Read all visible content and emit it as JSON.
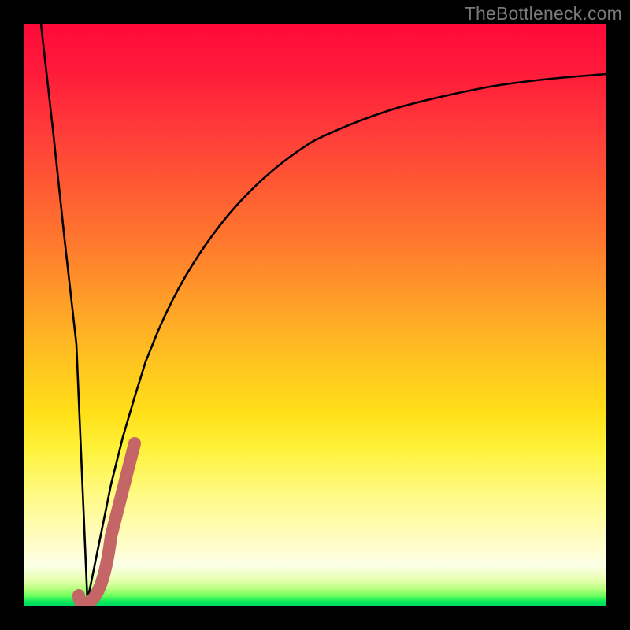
{
  "watermark": "TheBottleneck.com",
  "colors": {
    "curve_black": "#000000",
    "j_overlay": "#c86b6b",
    "background": "#000000"
  },
  "overlay_glyph": "J",
  "chart_data": {
    "type": "line",
    "title": "",
    "xlabel": "",
    "ylabel": "",
    "xlim": [
      0,
      100
    ],
    "ylim": [
      0,
      100
    ],
    "grid": false,
    "legend": false,
    "series": [
      {
        "name": "bottleneck-vshape",
        "comment": "Steep V falling from top-left to minimum near x≈11, then rising along a concave curve approaching ~91 at right edge.",
        "x": [
          3,
          5,
          7,
          9,
          11,
          13,
          15,
          17,
          19,
          21,
          23,
          26,
          30,
          35,
          40,
          45,
          50,
          55,
          60,
          65,
          70,
          75,
          80,
          85,
          90,
          95,
          100
        ],
        "y": [
          100,
          82,
          63,
          45,
          1,
          11,
          21,
          29,
          36,
          42,
          47,
          54,
          61,
          68,
          73,
          77,
          80,
          82.5,
          84.5,
          86,
          87.2,
          88.2,
          89,
          89.7,
          90.2,
          90.7,
          91
        ]
      }
    ],
    "annotations": [
      {
        "name": "J-overlay",
        "comment": "Thick reddish J-shaped stroke near the notch bottom, left side of chart.",
        "approx_bbox_x": [
          9.5,
          19
        ],
        "approx_bbox_y": [
          -1,
          28
        ]
      }
    ]
  }
}
